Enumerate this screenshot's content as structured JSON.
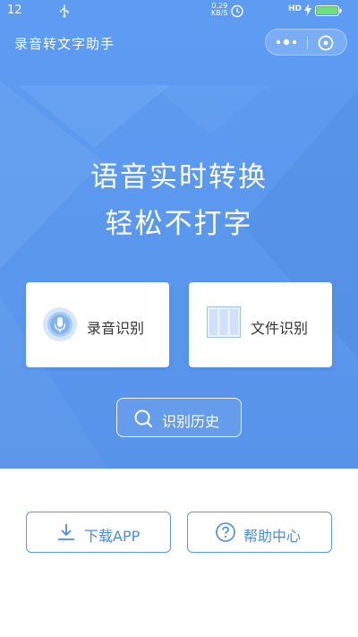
{
  "status_bar": {
    "time": "12",
    "net_speed_value": "0.29",
    "net_speed_unit": "KB/S",
    "network_type": "HD",
    "icons": [
      "usb-icon",
      "alarm-icon",
      "charging-icon",
      "battery-icon"
    ]
  },
  "app_bar": {
    "title": "录音转文字助手",
    "capsule_icons": [
      "more-icon",
      "close-icon"
    ]
  },
  "hero": {
    "line1": "语音实时转换",
    "line2": "轻松不打字",
    "cards": [
      {
        "label": "录音识别",
        "icon": "microphone-icon"
      },
      {
        "label": "文件识别",
        "icon": "document-icon"
      }
    ],
    "history_button": {
      "label": "识别历史",
      "icon": "search-icon"
    }
  },
  "bottom": {
    "download_button": {
      "label": "下载APP",
      "icon": "download-icon"
    },
    "help_button": {
      "label": "帮助中心",
      "icon": "help-icon"
    }
  },
  "colors": {
    "primary_blue": "#5b97ec",
    "hero_background": "#5d9cf2",
    "card_background": "#ffffff",
    "button_text": "#4a8be6"
  }
}
